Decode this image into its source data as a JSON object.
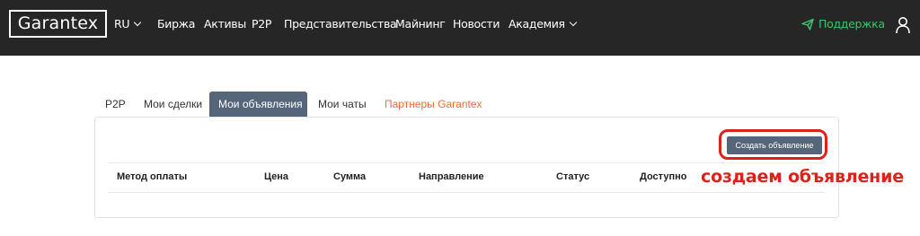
{
  "header": {
    "logo": "Garantex",
    "language": "RU",
    "nav": [
      "Биржа",
      "Активы",
      "P2P",
      "Представительства",
      "Майнинг",
      "Новости",
      "Академия"
    ],
    "support": "Поддержка"
  },
  "tabs": [
    {
      "label": "P2P"
    },
    {
      "label": "Мои сделки"
    },
    {
      "label": "Мои объявления",
      "active": true
    },
    {
      "label": "Мои чаты"
    },
    {
      "label": "Партнеры Garantex"
    }
  ],
  "main": {
    "create_button": "Создать объявление",
    "columns": [
      "Метод оплаты",
      "Цена",
      "Сумма",
      "Направление",
      "Статус",
      "Доступно"
    ]
  },
  "annotation": "создаем объявление",
  "colors": {
    "topbar": "#262626",
    "support": "#3cc46b",
    "active_tab": "#56657a",
    "partner_tab": "#f26d3d",
    "annotation": "#e0201a"
  }
}
